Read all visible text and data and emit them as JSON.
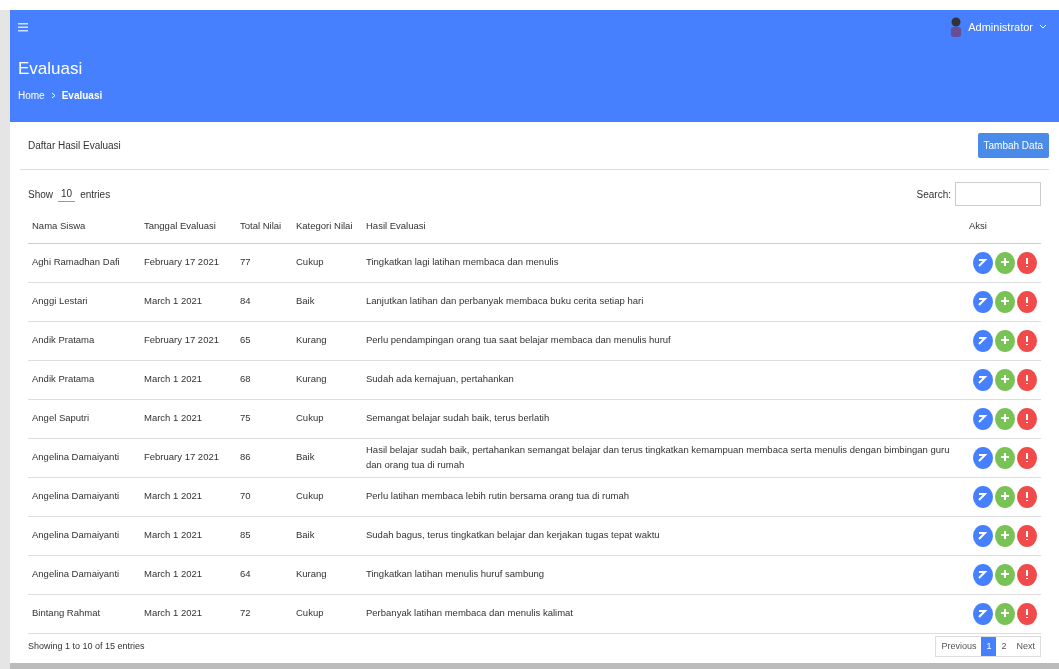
{
  "topbar": {
    "user_name": "Administrator"
  },
  "header": {
    "title": "Evaluasi",
    "breadcrumb": [
      "Home",
      "Evaluasi"
    ]
  },
  "card": {
    "title": "Daftar Hasil Evaluasi",
    "add_button": "Tambah Data"
  },
  "table_controls": {
    "show_label": "Show",
    "page_size": "10",
    "entries_label": "entries",
    "search_label": "Search:"
  },
  "table": {
    "columns": [
      "Nama Siswa",
      "Tanggal Evaluasi",
      "Total Nilai",
      "Kategori Nilai",
      "Hasil Evaluasi",
      "Aksi"
    ],
    "rows": [
      {
        "cells": [
          "Aghi Ramadhan Dafi",
          "February 17 2021",
          "77",
          "Cukup",
          "Tingkatkan lagi latihan membaca dan menulis"
        ]
      },
      {
        "cells": [
          "Anggi Lestari",
          "March 1 2021",
          "84",
          "Baik",
          "Lanjutkan latihan dan perbanyak membaca buku cerita setiap hari"
        ]
      },
      {
        "cells": [
          "Andik Pratama",
          "February 17 2021",
          "65",
          "Kurang",
          "Perlu pendampingan orang tua saat belajar membaca dan menulis huruf"
        ]
      },
      {
        "cells": [
          "Andik Pratama",
          "March 1 2021",
          "68",
          "Kurang",
          "Sudah ada kemajuan, pertahankan"
        ]
      },
      {
        "cells": [
          "Angel Saputri",
          "March 1 2021",
          "75",
          "Cukup",
          "Semangat belajar sudah baik, terus berlatih"
        ]
      },
      {
        "cells": [
          "Angelina Damaiyanti",
          "February 17 2021",
          "86",
          "Baik",
          "Hasil belajar sudah baik, pertahankan semangat belajar dan terus tingkatkan kemampuan membaca serta menulis dengan bimbingan guru dan orang tua di rumah"
        ]
      },
      {
        "cells": [
          "Angelina Damaiyanti",
          "March 1 2021",
          "70",
          "Cukup",
          "Perlu latihan membaca lebih rutin bersama orang tua di rumah"
        ]
      },
      {
        "cells": [
          "Angelina Damaiyanti",
          "March 1 2021",
          "85",
          "Baik",
          "Sudah bagus, terus tingkatkan belajar dan kerjakan tugas tepat waktu"
        ]
      },
      {
        "cells": [
          "Angelina Damaiyanti",
          "March 1 2021",
          "64",
          "Kurang",
          "Tingkatkan latihan menulis huruf sambung"
        ]
      },
      {
        "cells": [
          "Bintang Rahmat",
          "March 1 2021",
          "72",
          "Cukup",
          "Perbanyak latihan membaca dan menulis kalimat"
        ]
      }
    ]
  },
  "footer": {
    "info": "Showing 1 to 10 of 15 entries",
    "pagination": [
      {
        "label": "Previous",
        "selected": false
      },
      {
        "label": "1",
        "selected": true
      },
      {
        "label": "2",
        "selected": false
      },
      {
        "label": "Next",
        "selected": false
      }
    ]
  }
}
